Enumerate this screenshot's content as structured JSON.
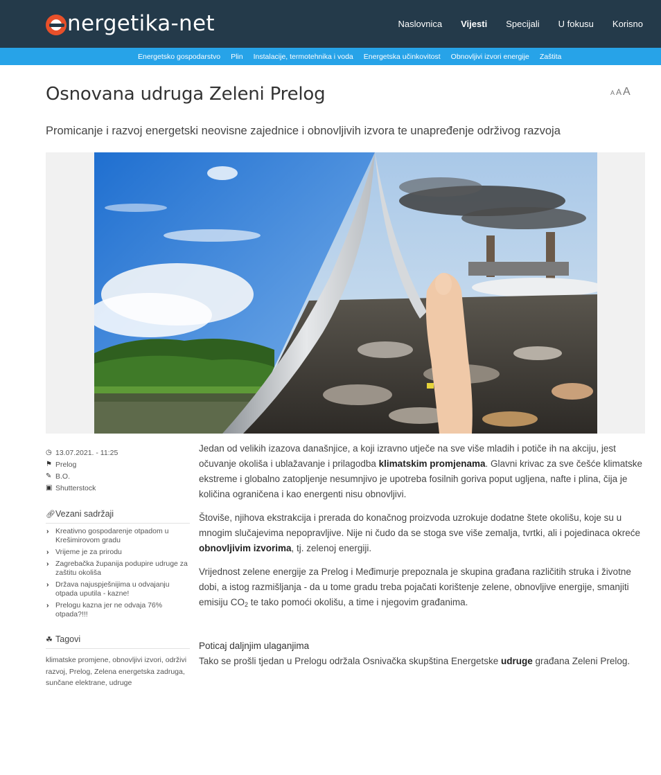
{
  "header": {
    "logo_text": "nergetika-net",
    "nav": [
      "Naslovnica",
      "Vijesti",
      "Specijali",
      "U fokusu",
      "Korisno"
    ],
    "active_nav": "Vijesti",
    "subnav": [
      "Energetsko gospodarstvo",
      "Plin",
      "Instalacije, termotehnika i voda",
      "Energetska učinkovitost",
      "Obnovljivi izvori energije",
      "Zaštita"
    ]
  },
  "article": {
    "title": "Osnovana udruga Zeleni Prelog",
    "subtitle": "Promicanje i razvoj energetski neovisne zajednice i obnovljivih izvora te unapređenje održivog razvoja",
    "font_size_controls": [
      "A",
      "A",
      "A"
    ],
    "hero_image": "landscape-vs-pollution-page-peel"
  },
  "meta": {
    "date": "13.07.2021. - 11:25",
    "location": "Prelog",
    "author": "B.O.",
    "photo": "Shutterstock"
  },
  "related": {
    "title": "Vezani sadržaji",
    "items": [
      "Kreativno gospodarenje otpadom u Krešimirovom gradu",
      "Vrijeme je za prirodu",
      "Zagrebačka županija podupire udruge za zaštitu okoliša",
      "Država najuspješnijima u odvajanju otpada uputila - kazne!",
      "Prelogu kazna jer ne odvaja 76% otpada?!!!"
    ]
  },
  "tags": {
    "title": "Tagovi",
    "text": "klimatske promjene, obnovljivi izvori, održivi razvoj, Prelog, Zelena energetska zadruga, sunčane elektrane, udruge"
  },
  "body": {
    "p1": {
      "a": "Jedan od velikih izazova današnjice, a koji izravno utječe na sve više mladih i potiče ih na akciju, jest očuvanje okoliša i ublažavanje i prilagodba ",
      "b": "klimatskim promjenama",
      "c": ". Glavni krivac za sve češće klimatske ekstreme i globalno zatopljenje nesumnjivo je upotreba fosilnih goriva poput ugljena, nafte i plina, čija je količina ograničena i kao energenti nisu obnovljivi."
    },
    "p2": {
      "a": "Štoviše, njihova ekstrakcija i prerada do konačnog proizvoda uzrokuje dodatne štete okolišu, koje su u mnogim slučajevima nepopravljive. Nije ni čudo da se stoga sve više zemalja, tvrtki, ali i pojedinaca okreće ",
      "b": "obnovljivim izvorima",
      "c": ", tj. zelenoj energiji."
    },
    "p3": {
      "a": "Vrijednost zelene energije za Prelog i Međimurje prepoznala je skupina građana različitih struka i životne dobi, a istog razmišljanja - da u tome gradu treba pojačati korištenje zelene, obnovljive energije, smanjiti emisiju CO",
      "sub": "2",
      "c": " te tako pomoći okolišu, a time i njegovim građanima."
    },
    "heading": "Poticaj daljnjim ulaganjima",
    "p4": {
      "a": "Tako se prošli tjedan u Prelogu održala Osnivačka skupština Energetske ",
      "b": "udruge",
      "c": " građana Zeleni Prelog."
    }
  }
}
